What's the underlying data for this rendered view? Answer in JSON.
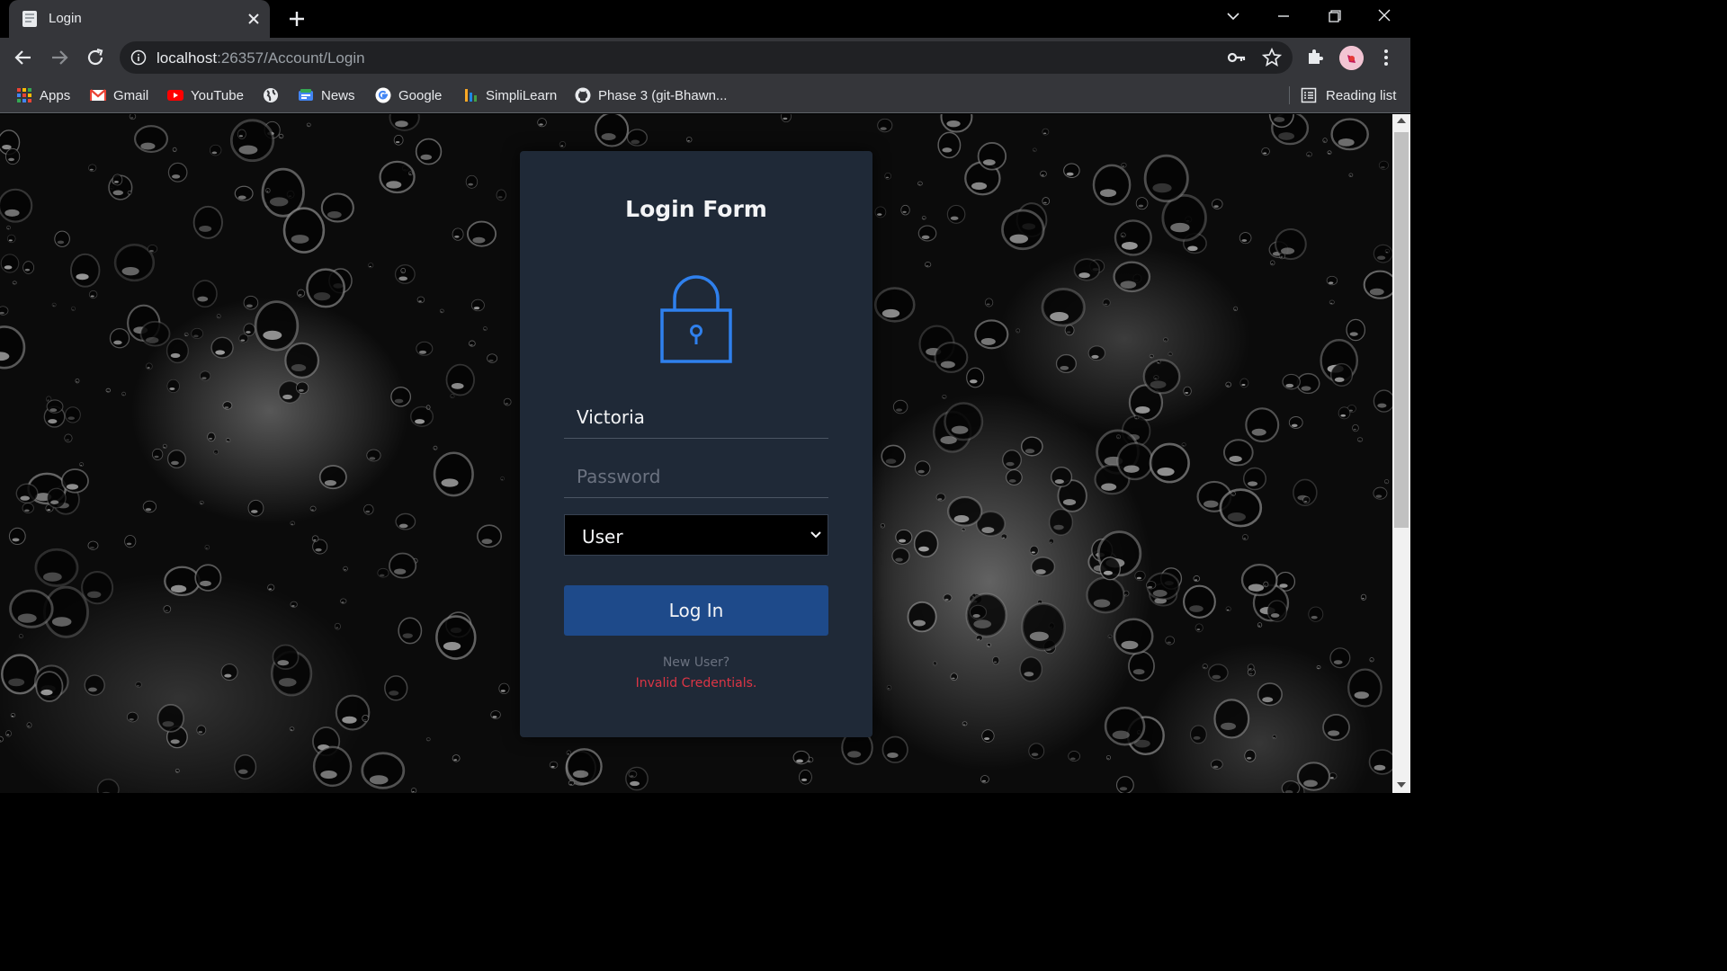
{
  "browser": {
    "tab": {
      "title": "Login"
    },
    "address": {
      "host": "localhost",
      "path": ":26357/Account/Login"
    },
    "bookmarks": [
      {
        "label": "Apps",
        "icon": "apps-grid-icon"
      },
      {
        "label": "Gmail",
        "icon": "gmail-icon"
      },
      {
        "label": "YouTube",
        "icon": "youtube-icon"
      },
      {
        "label": "",
        "icon": "globe-icon"
      },
      {
        "label": "News",
        "icon": "news-icon"
      },
      {
        "label": "Google",
        "icon": "google-icon"
      },
      {
        "label": "SimpliLearn",
        "icon": "simplilearn-icon"
      },
      {
        "label": "Phase 3 (git-Bhawn...",
        "icon": "github-icon"
      }
    ],
    "reading_list": "Reading list"
  },
  "login": {
    "title": "Login Form",
    "username_value": "Victoria",
    "password_placeholder": "Password",
    "role_selected": "User",
    "submit_label": "Log In",
    "new_user_text": "New User?",
    "error_text": "Invalid Credentials."
  },
  "colors": {
    "card_bg": "#1f2937",
    "accent_blue": "#2f80ed",
    "button_bg": "#1e4a8a",
    "error_red": "#dc3545"
  }
}
